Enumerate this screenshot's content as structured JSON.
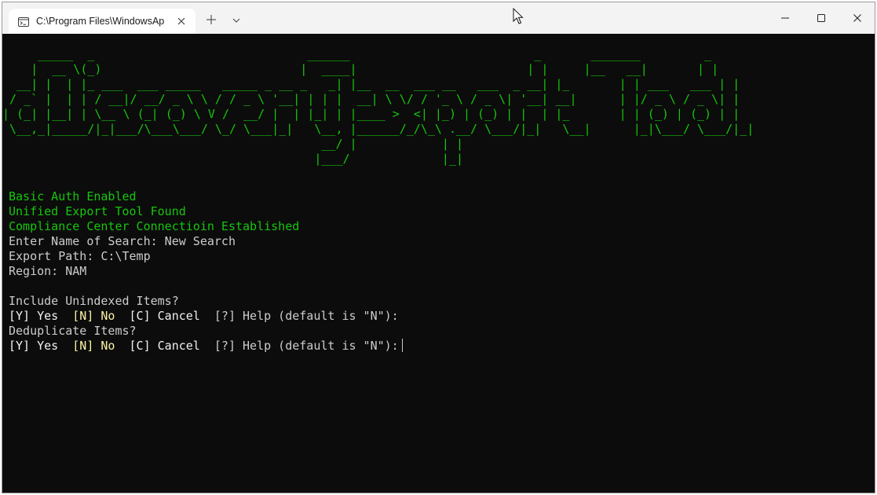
{
  "window": {
    "tab_title": "C:\\Program Files\\WindowsAp",
    "icons": {
      "tab": "terminal-icon",
      "close_tab": "close-icon",
      "new_tab": "plus-icon",
      "dropdown": "chevron-down-icon",
      "minimize": "minimize-icon",
      "maximize": "maximize-icon",
      "close": "close-icon"
    }
  },
  "colors": {
    "background": "#0c0c0c",
    "green": "#16c60c",
    "text": "#cccccc",
    "bright": "#f2f2f2",
    "yellow": "#f9f1a5"
  },
  "terminal": {
    "banner": "     _____  _                              ______                          _       _______         _\n    |  __ \\(_)                            |  ____|                        | |     |__   __|       | |\n  __| |  | |_ ___  ___ _____   _____ _ __ _   _| |__  __  ___ __   ___  _ __| |_       | | ___   ___ | |\n / _` |  | | / __|/ __/ _ \\ \\ / / _ \\ '__| | | |  __| \\ \\/ / '_ \\ / _ \\| '__| __|      | |/ _ \\ / _ \\| |\n| (_| |__| | \\__ \\ (_| (_) \\ V /  __/ |  | |_| | |____ >  <| |_) | (_) | |  | |_       | | (_) | (_) | |\n \\__,_|_____/|_|___/\\___\\___/ \\_/ \\___|_|   \\__, |______/_/\\_\\ .__/ \\___/|_|   \\__|      |_|\\___/ \\___/|_|\n                                             __/ |            | |\n                                            |___/             |_|",
    "status_lines": [
      "Basic Auth Enabled",
      "Unified Export Tool Found",
      "Compliance Center Connectioin Established"
    ],
    "search_name_prompt": "Enter Name of Search: New Search",
    "export_path": "Export Path: C:\\Temp",
    "region": "Region: NAM",
    "unindexed_question": "Include Unindexed Items?",
    "dedupe_question": "Deduplicate Items?",
    "choice_yes": "[Y] Yes",
    "choice_no": "[N] No",
    "choice_cancel": "[C] Cancel",
    "choice_help": "[?] Help (default is \"N\"):"
  }
}
